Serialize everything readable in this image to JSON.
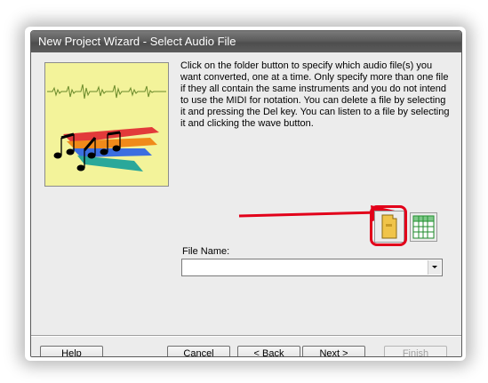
{
  "window": {
    "title": "New Project Wizard - Select Audio File"
  },
  "description": "Click on the folder button to specify which audio file(s) you want converted, one at a time. Only specify more than one file if they all contain the same instruments and you do not intend to use the MIDI for notation. You can delete a file by selecting it and pressing the Del key. You can listen to a file by selecting it and clicking the wave button.",
  "file_name": {
    "label": "File Name:",
    "value": ""
  },
  "icons": {
    "folder": "folder-icon",
    "wave": "wave-icon",
    "dropdown": "chevron-down-icon"
  },
  "colors": {
    "highlight": "#e2001a",
    "art_background": "#f3f39a"
  },
  "buttons": {
    "help": {
      "underline": "H",
      "rest": "elp"
    },
    "cancel": {
      "underline": "C",
      "rest": "ancel"
    },
    "back": {
      "prefix": "< ",
      "underline": "B",
      "rest": "ack"
    },
    "next": {
      "underline": "N",
      "rest": "ext >"
    },
    "finish": {
      "label": "Finish"
    }
  }
}
